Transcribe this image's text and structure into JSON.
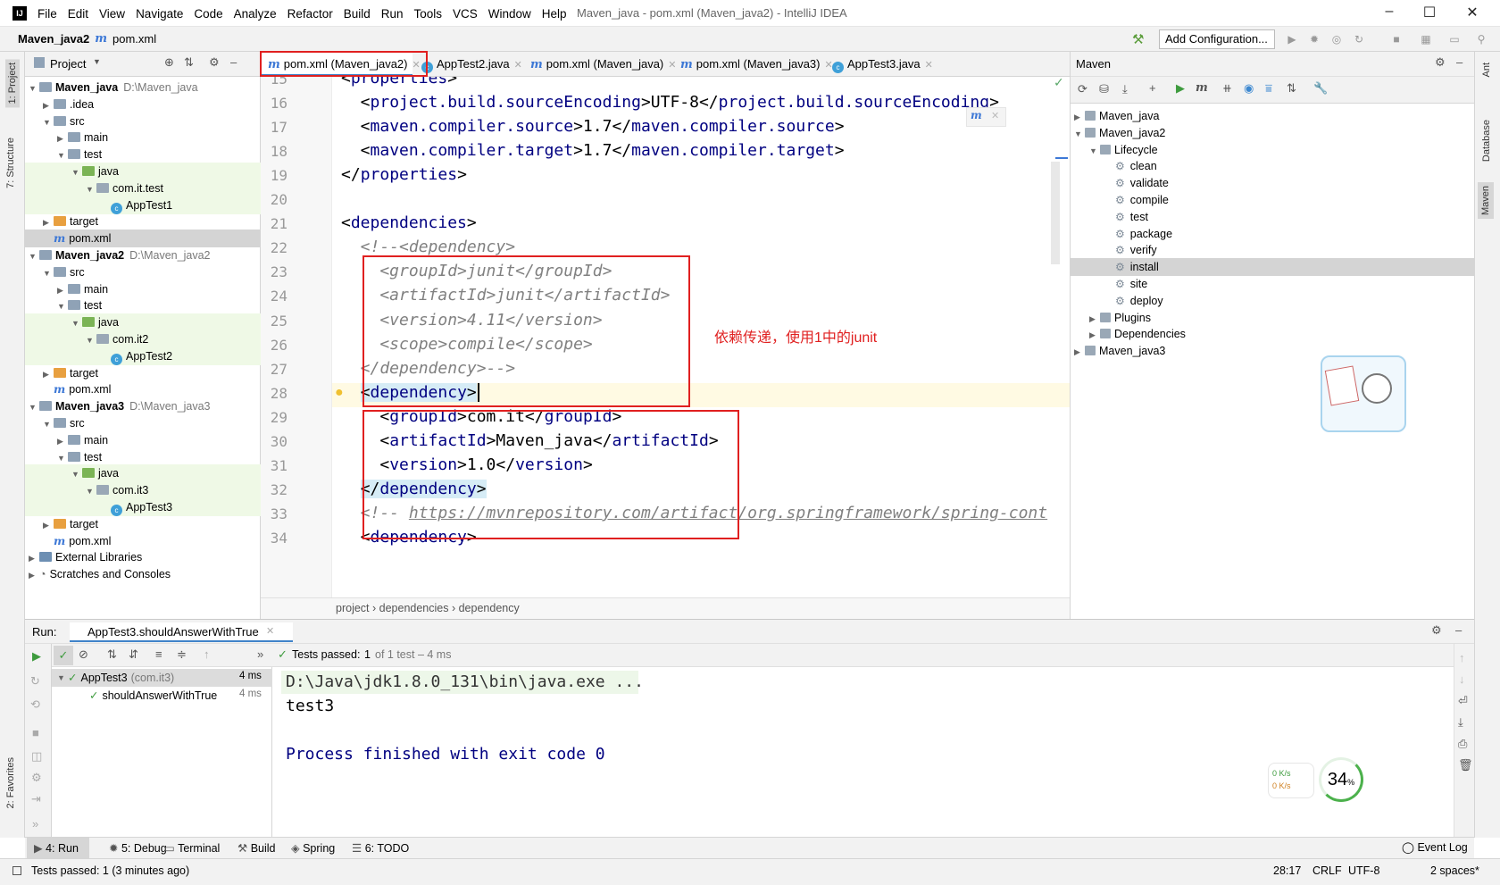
{
  "window": {
    "title": "Maven_java - pom.xml (Maven_java2) - IntelliJ IDEA",
    "logo": "IJ"
  },
  "menu": [
    "File",
    "Edit",
    "View",
    "Navigate",
    "Code",
    "Analyze",
    "Refactor",
    "Build",
    "Run",
    "Tools",
    "VCS",
    "Window",
    "Help"
  ],
  "navbar": {
    "project": "Maven_java2",
    "file": "pom.xml",
    "add_config": "Add Configuration..."
  },
  "left_stripe": [
    "1: Project",
    "7: Structure",
    "2: Favorites"
  ],
  "right_stripe": [
    "Ant",
    "Database",
    "Maven"
  ],
  "project_panel": {
    "title": "Project",
    "rows": [
      {
        "label": "Maven_java",
        "path": "D:\\Maven_java",
        "bold": true
      },
      {
        "label": ".idea"
      },
      {
        "label": "src"
      },
      {
        "label": "main"
      },
      {
        "label": "test"
      },
      {
        "label": "java"
      },
      {
        "label": "com.it.test"
      },
      {
        "label": "AppTest1"
      },
      {
        "label": "target"
      },
      {
        "label": "pom.xml"
      },
      {
        "label": "Maven_java2",
        "path": "D:\\Maven_java2",
        "bold": true
      },
      {
        "label": "src"
      },
      {
        "label": "main"
      },
      {
        "label": "test"
      },
      {
        "label": "java"
      },
      {
        "label": "com.it2"
      },
      {
        "label": "AppTest2"
      },
      {
        "label": "target"
      },
      {
        "label": "pom.xml"
      },
      {
        "label": "Maven_java3",
        "path": "D:\\Maven_java3",
        "bold": true
      },
      {
        "label": "src"
      },
      {
        "label": "main"
      },
      {
        "label": "test"
      },
      {
        "label": "java"
      },
      {
        "label": "com.it3"
      },
      {
        "label": "AppTest3"
      },
      {
        "label": "target"
      },
      {
        "label": "pom.xml"
      },
      {
        "label": "External Libraries"
      },
      {
        "label": "Scratches and Consoles"
      }
    ]
  },
  "tabs": [
    "pom.xml (Maven_java2)",
    "AppTest2.java",
    "pom.xml (Maven_java)",
    "pom.xml (Maven_java3)",
    "AppTest3.java"
  ],
  "tab_icon": "m",
  "editor": {
    "line_numbers": [
      "15",
      "16",
      "17",
      "18",
      "19",
      "20",
      "21",
      "22",
      "23",
      "24",
      "25",
      "26",
      "27",
      "28",
      "29",
      "30",
      "31",
      "32",
      "33",
      "34"
    ],
    "lines": [
      "<properties>",
      "  <project.build.sourceEncoding>UTF-8</project.build.sourceEncoding>",
      "  <maven.compiler.source>1.7</maven.compiler.source>",
      "  <maven.compiler.target>1.7</maven.compiler.target>",
      "</properties>",
      "",
      "<dependencies>",
      "  <!--<dependency>",
      "    <groupId>junit</groupId>",
      "    <artifactId>junit</artifactId>",
      "    <version>4.11</version>",
      "    <scope>compile</scope>",
      "  </dependency>-->",
      "  <dependency>",
      "    <groupId>com.it</groupId>",
      "    <artifactId>Maven_java</artifactId>",
      "    <version>1.0</version>",
      "  </dependency>",
      "  <!-- https://mvnrepository.com/artifact/org.springframework/spring-cont",
      "  <dependency>"
    ],
    "annotation": "依赖传递，使用1中的junit",
    "breadcrumb": [
      "project",
      "dependencies",
      "dependency"
    ]
  },
  "maven_panel": {
    "title": "Maven",
    "rows": [
      {
        "label": "Maven_java"
      },
      {
        "label": "Maven_java2"
      },
      {
        "label": "Lifecycle"
      },
      {
        "label": "clean"
      },
      {
        "label": "validate"
      },
      {
        "label": "compile"
      },
      {
        "label": "test"
      },
      {
        "label": "package"
      },
      {
        "label": "verify"
      },
      {
        "label": "install"
      },
      {
        "label": "site"
      },
      {
        "label": "deploy"
      },
      {
        "label": "Plugins"
      },
      {
        "label": "Dependencies"
      },
      {
        "label": "Maven_java3"
      }
    ]
  },
  "run": {
    "label": "Run:",
    "config": "AppTest3.shouldAnswerWithTrue",
    "status_prefix": "Tests passed:",
    "status_count": "1",
    "status_suffix": "of 1 test – 4 ms",
    "tree": [
      {
        "label": "AppTest3",
        "pkg": "(com.it3)",
        "time": "4 ms"
      },
      {
        "label": "shouldAnswerWithTrue",
        "time": "4 ms"
      }
    ],
    "console": [
      "D:\\Java\\jdk1.8.0_131\\bin\\java.exe ...",
      "test3",
      "",
      "Process finished with exit code 0"
    ]
  },
  "net_widget": {
    "up": "0  K/s",
    "down": "0  K/s",
    "percent": "34",
    "unit": "%"
  },
  "bottom_tabs": [
    "4: Run",
    "5: Debug",
    "Terminal",
    "Build",
    "Spring",
    "6: TODO"
  ],
  "event_log": "Event Log",
  "statusbar": {
    "message": "Tests passed: 1 (3 minutes ago)",
    "position": "28:17",
    "line_sep": "CRLF",
    "encoding": "UTF-8",
    "indent": "2 spaces*"
  }
}
